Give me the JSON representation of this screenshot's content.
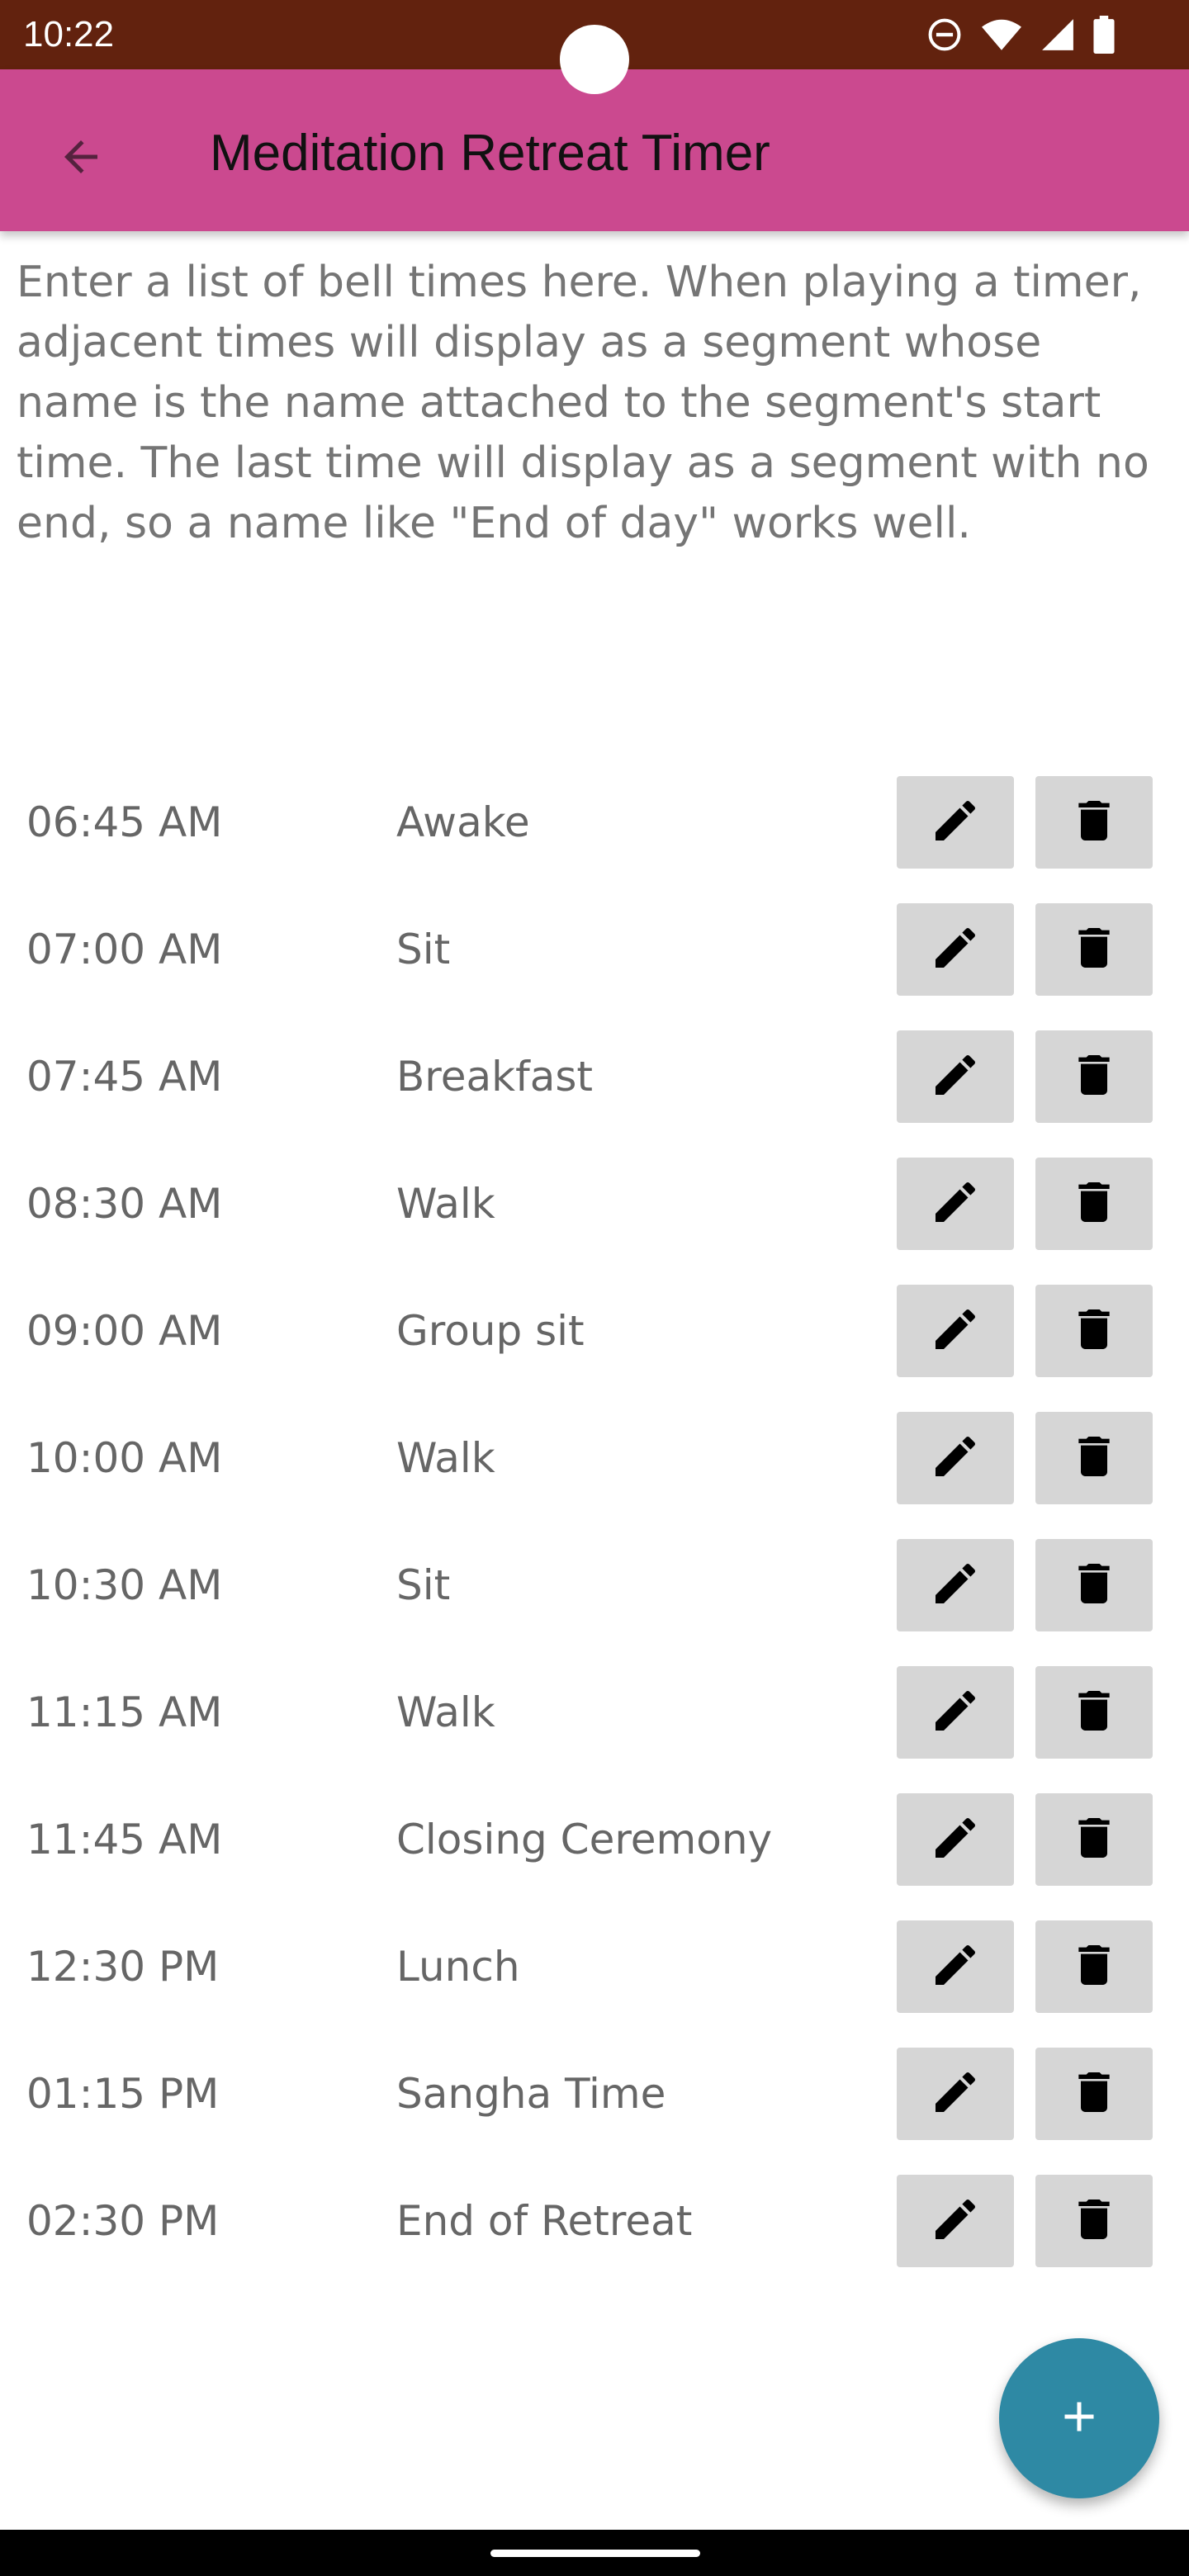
{
  "status_bar": {
    "time": "10:22",
    "icons": [
      "do-not-disturb-icon",
      "wifi-icon",
      "cellular-signal-icon",
      "battery-icon"
    ]
  },
  "app_bar": {
    "title": "Meditation Retreat Timer",
    "back_icon": "arrow-back-icon"
  },
  "intro": {
    "text": "Enter a list of bell times here. When playing a timer, adjacent times will display as a segment whose name is the name attached to the segment's start time. The last time will display as a segment with no end, so a name like \"End of day\" works well."
  },
  "bells": [
    {
      "time": "06:45 AM",
      "name": "Awake"
    },
    {
      "time": "07:00 AM",
      "name": "Sit"
    },
    {
      "time": "07:45 AM",
      "name": "Breakfast"
    },
    {
      "time": "08:30 AM",
      "name": "Walk"
    },
    {
      "time": "09:00 AM",
      "name": "Group sit"
    },
    {
      "time": "10:00 AM",
      "name": "Walk"
    },
    {
      "time": "10:30 AM",
      "name": "Sit"
    },
    {
      "time": "11:15 AM",
      "name": "Walk"
    },
    {
      "time": "11:45 AM",
      "name": "Closing Ceremony"
    },
    {
      "time": "12:30 PM",
      "name": "Lunch"
    },
    {
      "time": "01:15 PM",
      "name": "Sangha Time"
    },
    {
      "time": "02:30 PM",
      "name": "End of Retreat"
    }
  ],
  "row_actions": {
    "edit_icon": "pencil-icon",
    "delete_icon": "trash-icon"
  },
  "fab": {
    "icon": "plus-icon"
  },
  "colors": {
    "status_bar": "#62220e",
    "app_bar": "#cb498f",
    "fab": "#2e89a4",
    "button_bg": "#d6d6d6",
    "text_gray": "#666666"
  }
}
